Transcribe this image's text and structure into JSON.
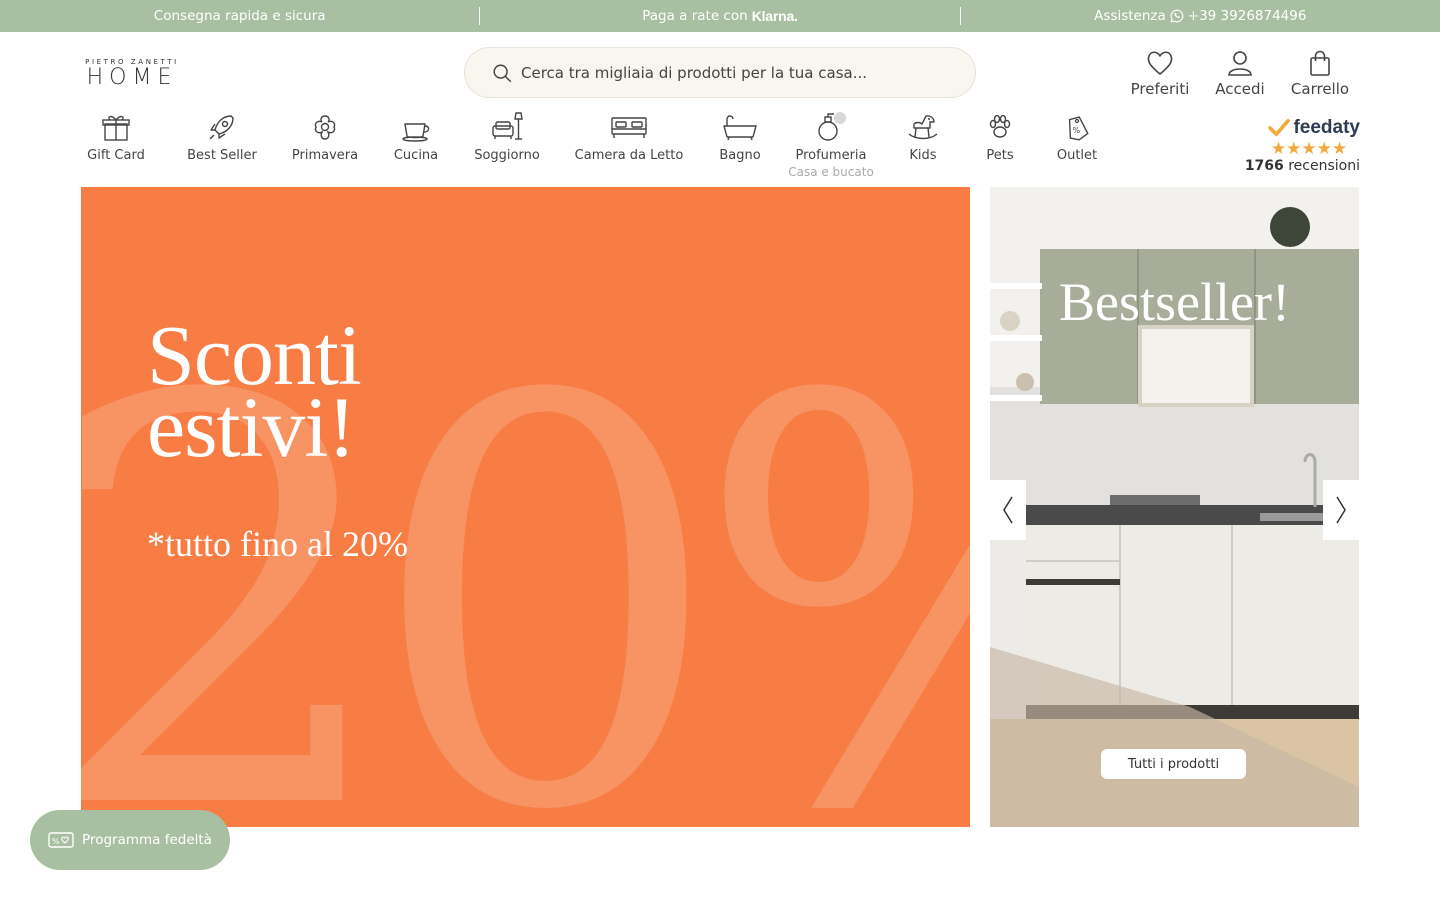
{
  "topbar": {
    "delivery": "Consegna rapida e sicura",
    "installments_prefix": "Paga a rate con",
    "installments_brand": "Klarna.",
    "support_label": "Assistenza",
    "support_phone": "+39 3926874496"
  },
  "logo": {
    "small": "PIETRO ZANETTI",
    "big": "HOME"
  },
  "search": {
    "placeholder": "Cerca tra migliaia di prodotti per la tua casa...",
    "icon": "search-icon"
  },
  "header_actions": [
    {
      "label": "Preferiti",
      "icon": "heart-icon"
    },
    {
      "label": "Accedi",
      "icon": "user-icon"
    },
    {
      "label": "Carrello",
      "icon": "bag-icon"
    }
  ],
  "categories": [
    {
      "label": "Gift Card",
      "icon": "gift-icon"
    },
    {
      "label": "Best Seller",
      "icon": "rocket-icon"
    },
    {
      "label": "Primavera",
      "icon": "flower-icon"
    },
    {
      "label": "Cucina",
      "icon": "cup-icon"
    },
    {
      "label": "Soggiorno",
      "icon": "sofa-lamp-icon"
    },
    {
      "label": "Camera da Letto",
      "icon": "bed-icon"
    },
    {
      "label": "Bagno",
      "icon": "bathtub-icon"
    },
    {
      "label": "Profumeria",
      "sub": "Casa e bucato",
      "icon": "perfume-icon"
    },
    {
      "label": "Kids",
      "icon": "rocking-horse-icon"
    },
    {
      "label": "Pets",
      "icon": "paw-icon"
    },
    {
      "label": "Outlet",
      "icon": "price-tag-icon"
    }
  ],
  "feedaty": {
    "brand": "feedaty",
    "stars": "★★★★★",
    "count": "1766",
    "count_suffix": "recensioni"
  },
  "hero_main": {
    "background_figure": "20%",
    "title_line1": "Sconti",
    "title_line2": "estivi!",
    "subtitle": "*tutto fino al 20%",
    "color": "#f77d45"
  },
  "hero_side": {
    "title": "Bestseller!",
    "cta": "Tutti i prodotti",
    "prev_icon": "chevron-left-icon",
    "next_icon": "chevron-right-icon"
  },
  "loyalty": {
    "label": "Programma fedeltà",
    "icon": "loyalty-card-icon"
  },
  "colors": {
    "accent": "#a9bfa2",
    "promo": "#f77d45"
  }
}
